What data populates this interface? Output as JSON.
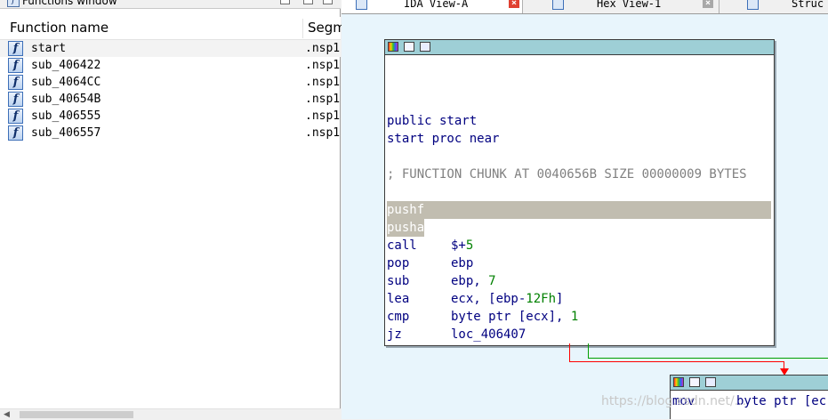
{
  "functions_window": {
    "title": "Functions window",
    "columns": {
      "name": "Function name",
      "segment": "Segme"
    },
    "rows": [
      {
        "name": "start",
        "segment": ".nsp1"
      },
      {
        "name": "sub_406422",
        "segment": ".nsp1"
      },
      {
        "name": "sub_4064CC",
        "segment": ".nsp1"
      },
      {
        "name": "sub_40654B",
        "segment": ".nsp1"
      },
      {
        "name": "sub_406555",
        "segment": ".nsp1"
      },
      {
        "name": "sub_406557",
        "segment": ".nsp1"
      }
    ],
    "function_icon": "f"
  },
  "tabs": [
    {
      "label": "IDA View-A",
      "icon": "ida-view-icon"
    },
    {
      "label": "Hex View-1",
      "icon": "hex-view-icon"
    },
    {
      "label": "Struc",
      "icon": "structures-icon"
    }
  ],
  "graph": {
    "main_node": {
      "lines": [
        {
          "text": "public start"
        },
        {
          "text": "start proc near"
        },
        {
          "text": "; FUNCTION CHUNK AT 0040656B SIZE 00000009 BYTES"
        },
        {
          "mnemonic": "pushf"
        },
        {
          "mnemonic": "pusha"
        },
        {
          "mnemonic": "call",
          "operand": "$+",
          "num": "5"
        },
        {
          "mnemonic": "pop",
          "operand": "ebp"
        },
        {
          "mnemonic": "sub",
          "operand": "ebp, ",
          "num": "7"
        },
        {
          "mnemonic": "lea",
          "operand": "ecx, [ebp-",
          "num": "12Fh",
          "operand_tail": "]"
        },
        {
          "mnemonic": "cmp",
          "operand": "byte ptr [ecx], ",
          "num": "1"
        },
        {
          "mnemonic": "jz",
          "operand": "loc_406407"
        }
      ]
    },
    "second_node": {
      "mnemonic": "mov",
      "operand": "byte ptr [ec"
    },
    "watermark": "https://blog.csdn.net/..."
  },
  "colors": {
    "graph_bg": "#e8f5fc",
    "node_title": "#9ecfd6",
    "highlight": "#c1bdb0",
    "code_text": "#000080",
    "number_text": "#008000",
    "edge_false": "#ff0000",
    "edge_true": "#00a000"
  }
}
